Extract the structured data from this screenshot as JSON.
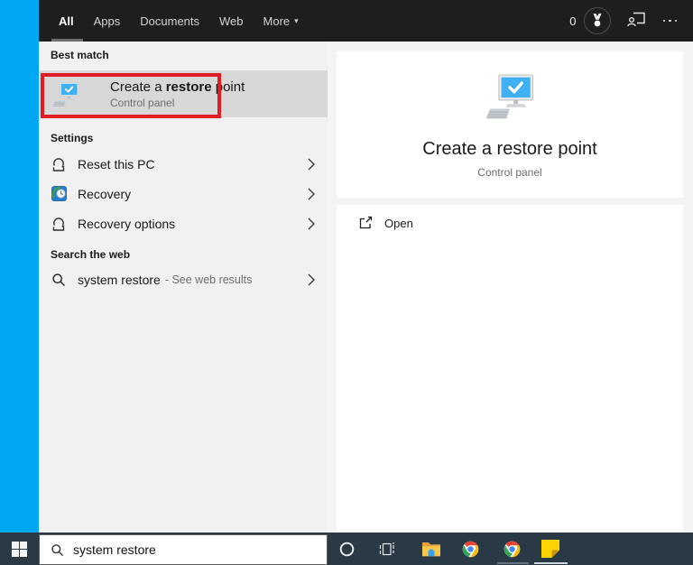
{
  "colors": {
    "desktop_blue": "#00a8f4",
    "header_bg": "#1e1e1e",
    "panel_bg": "#f1f1f1",
    "selected_row_bg": "#d8d8d8",
    "annotation_red": "#e11c24",
    "taskbar_bg": "#293a46",
    "restore_icon_screen_blue": "#3fb0f2",
    "chrome_red": "#ea4335",
    "chrome_green": "#34a853",
    "chrome_yellow": "#fbbc05",
    "chrome_blue": "#4285f4",
    "sticky_note_yellow": "#ffd400",
    "folder_yellow": "#f7c64a"
  },
  "header": {
    "tabs": [
      {
        "label": "All",
        "active": true
      },
      {
        "label": "Apps",
        "active": false
      },
      {
        "label": "Documents",
        "active": false
      },
      {
        "label": "Web",
        "active": false
      },
      {
        "label": "More",
        "active": false
      }
    ],
    "rewards_count": "0"
  },
  "left_panel": {
    "best_match": {
      "header": "Best match",
      "title_prefix": "Create a ",
      "title_em": "restore",
      "title_suffix": " point",
      "subtitle": "Control panel"
    },
    "settings": {
      "header": "Settings",
      "items": [
        {
          "label": "Reset this PC",
          "icon": "reset-icon"
        },
        {
          "label": "Recovery",
          "icon": "recovery-icon"
        },
        {
          "label": "Recovery options",
          "icon": "reset-icon"
        }
      ]
    },
    "search_web": {
      "header": "Search the web",
      "query": "system restore",
      "suffix": "- See web results"
    }
  },
  "preview": {
    "title": "Create a restore point",
    "subtitle": "Control panel",
    "actions": [
      {
        "label": "Open",
        "icon": "open-external-icon"
      }
    ]
  },
  "taskbar": {
    "search_value": "system restore",
    "apps": [
      "cortana",
      "task-view",
      "file-explorer",
      "chrome",
      "chrome",
      "sticky-notes"
    ]
  }
}
